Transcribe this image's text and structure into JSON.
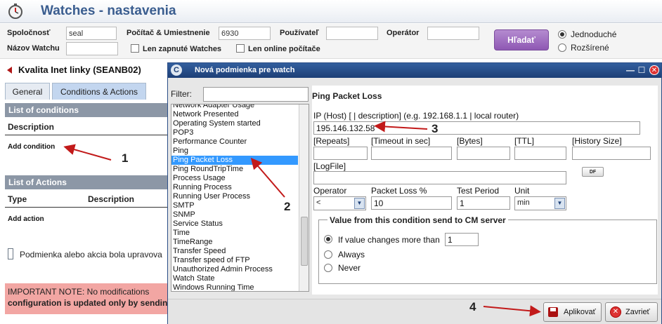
{
  "app": {
    "title": "Watches - nastavenia",
    "icon": "stopwatch-icon"
  },
  "filters": {
    "company_label": "Spoločnosť",
    "company_value": "seal",
    "computer_label": "Počítač & Umiestnenie",
    "computer_value": "6930",
    "user_label": "Používateľ",
    "user_value": "",
    "operator_label": "Operátor",
    "operator_value": "",
    "watch_name_label": "Názov Watchu",
    "watch_name_value": "",
    "only_enabled_label": "Len zapnuté Watches",
    "only_online_label": "Len online počítače",
    "search_label": "Hľadať",
    "mode_simple": "Jednoduché",
    "mode_extended": "Rozšírené"
  },
  "left": {
    "title": "Kvalita Inet linky (SEANB02)",
    "tabs": [
      "General",
      "Conditions & Actions"
    ],
    "conditions_header": "List of conditions",
    "conditions_col": "Description",
    "add_condition": "Add condition",
    "actions_header": "List of Actions",
    "actions_col_type": "Type",
    "actions_col_desc": "Description",
    "add_action": "Add action",
    "note": "Podmienka alebo akcia bola upravova",
    "warn_line1": "IMPORTANT NOTE: No modifications",
    "warn_line2": "configuration is updated only by sending"
  },
  "dialog": {
    "title": "Nová podmienka pre watch",
    "filter_label": "Filter:",
    "filter_value": "",
    "list": [
      "Network Adapter Usage",
      "Network Presented",
      "Operating System started",
      "POP3",
      "Performance Counter",
      "Ping",
      "Ping Packet Loss",
      "Ping RoundTripTime",
      "Process Usage",
      "Running Process",
      "Running User Process",
      "SMTP",
      "SNMP",
      "Service Status",
      "Time",
      "TimeRange",
      "Transfer Speed",
      "Transfer speed of FTP",
      "Unauthorized Admin Process",
      "Watch State",
      "Windows Running Time"
    ],
    "selected_index": 6,
    "panel": {
      "title": "Ping Packet Loss",
      "ip_label": "IP (Host) [ | description] (e.g. 192.168.1.1 | local router)",
      "ip_value": "195.146.132.58",
      "repeats_label": "[Repeats]",
      "timeout_label": "[Timeout in sec]",
      "bytes_label": "[Bytes]",
      "ttl_label": "[TTL]",
      "history_label": "[History Size]",
      "logfile_label": "[LogFile]",
      "df_label": "DF",
      "operator_label": "Operator",
      "operator_value": "<",
      "packet_loss_label": "Packet Loss %",
      "packet_loss_value": "10",
      "test_period_label": "Test Period",
      "test_period_value": "1",
      "unit_label": "Unit",
      "unit_value": "min",
      "group_title": "Value from this condition send to CM server",
      "opt_changes": "If value changes more than",
      "opt_changes_value": "1",
      "opt_always": "Always",
      "opt_never": "Never"
    },
    "apply_label": "Aplikovať",
    "close_label": "Zavrieť"
  },
  "annotations": [
    "1",
    "2",
    "3",
    "4"
  ]
}
